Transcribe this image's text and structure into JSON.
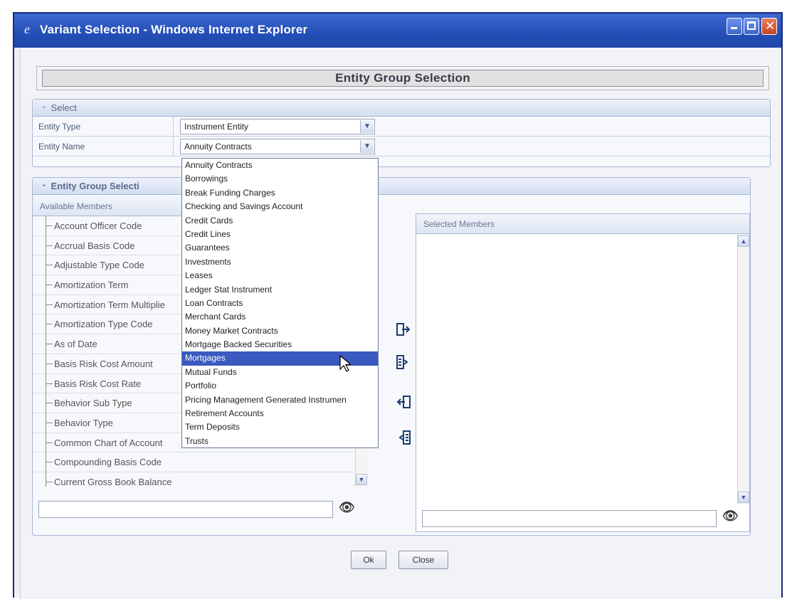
{
  "window": {
    "title": "Variant Selection - Windows Internet Explorer",
    "icon": "ie-icon"
  },
  "header": {
    "title": "Entity Group Selection"
  },
  "select_panel": {
    "title": "Select",
    "rows": [
      {
        "label": "Entity Type",
        "value": "Instrument Entity"
      },
      {
        "label": "Entity Name",
        "value": "Annuity Contracts"
      }
    ]
  },
  "group_panel": {
    "title": "Entity Group Selecti",
    "available_header": "Available Members",
    "selected_header": "Selected Members",
    "available_members": [
      "Account Officer Code",
      "Accrual Basis Code",
      "Adjustable Type Code",
      "Amortization Term",
      "Amortization Term Multiplie",
      "Amortization Type Code",
      "As of Date",
      "Basis Risk Cost Amount",
      "Basis Risk Cost Rate",
      "Behavior Sub Type",
      "Behavior Type",
      "Common Chart of Account",
      "Compounding Basis Code",
      "Current Gross Book Balance"
    ],
    "selected_members": []
  },
  "entity_name_dropdown": {
    "options": [
      "Annuity Contracts",
      "Borrowings",
      "Break Funding Charges",
      "Checking and Savings Account",
      "Credit Cards",
      "Credit Lines",
      "Guarantees",
      "Investments",
      "Leases",
      "Ledger Stat Instrument",
      "Loan Contracts",
      "Merchant Cards",
      "Money Market Contracts",
      "Mortgage Backed Securities",
      "Mortgages",
      "Mutual Funds",
      "Portfolio",
      "Pricing Management Generated Instrumen",
      "Retirement Accounts",
      "Term Deposits",
      "Trusts"
    ],
    "highlighted": "Mortgages"
  },
  "buttons": {
    "ok": "Ok",
    "close": "Close"
  },
  "colors": {
    "titlebar": "#2450b8",
    "highlight": "#3a5ac0",
    "panel_border": "#a8b7d6"
  }
}
